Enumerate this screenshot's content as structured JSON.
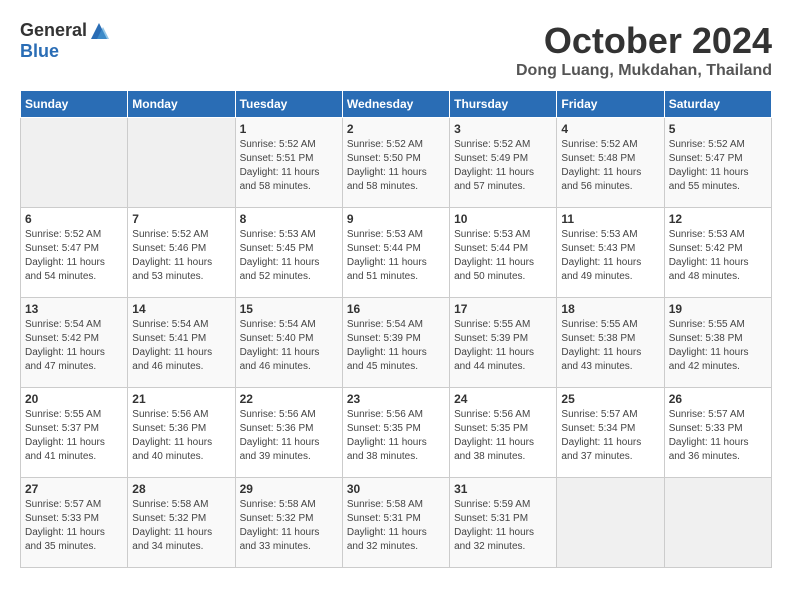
{
  "logo": {
    "general": "General",
    "blue": "Blue"
  },
  "title": "October 2024",
  "subtitle": "Dong Luang, Mukdahan, Thailand",
  "days_of_week": [
    "Sunday",
    "Monday",
    "Tuesday",
    "Wednesday",
    "Thursday",
    "Friday",
    "Saturday"
  ],
  "weeks": [
    [
      {
        "day": "",
        "info": ""
      },
      {
        "day": "",
        "info": ""
      },
      {
        "day": "1",
        "info": "Sunrise: 5:52 AM\nSunset: 5:51 PM\nDaylight: 11 hours and 58 minutes."
      },
      {
        "day": "2",
        "info": "Sunrise: 5:52 AM\nSunset: 5:50 PM\nDaylight: 11 hours and 58 minutes."
      },
      {
        "day": "3",
        "info": "Sunrise: 5:52 AM\nSunset: 5:49 PM\nDaylight: 11 hours and 57 minutes."
      },
      {
        "day": "4",
        "info": "Sunrise: 5:52 AM\nSunset: 5:48 PM\nDaylight: 11 hours and 56 minutes."
      },
      {
        "day": "5",
        "info": "Sunrise: 5:52 AM\nSunset: 5:47 PM\nDaylight: 11 hours and 55 minutes."
      }
    ],
    [
      {
        "day": "6",
        "info": "Sunrise: 5:52 AM\nSunset: 5:47 PM\nDaylight: 11 hours and 54 minutes."
      },
      {
        "day": "7",
        "info": "Sunrise: 5:52 AM\nSunset: 5:46 PM\nDaylight: 11 hours and 53 minutes."
      },
      {
        "day": "8",
        "info": "Sunrise: 5:53 AM\nSunset: 5:45 PM\nDaylight: 11 hours and 52 minutes."
      },
      {
        "day": "9",
        "info": "Sunrise: 5:53 AM\nSunset: 5:44 PM\nDaylight: 11 hours and 51 minutes."
      },
      {
        "day": "10",
        "info": "Sunrise: 5:53 AM\nSunset: 5:44 PM\nDaylight: 11 hours and 50 minutes."
      },
      {
        "day": "11",
        "info": "Sunrise: 5:53 AM\nSunset: 5:43 PM\nDaylight: 11 hours and 49 minutes."
      },
      {
        "day": "12",
        "info": "Sunrise: 5:53 AM\nSunset: 5:42 PM\nDaylight: 11 hours and 48 minutes."
      }
    ],
    [
      {
        "day": "13",
        "info": "Sunrise: 5:54 AM\nSunset: 5:42 PM\nDaylight: 11 hours and 47 minutes."
      },
      {
        "day": "14",
        "info": "Sunrise: 5:54 AM\nSunset: 5:41 PM\nDaylight: 11 hours and 46 minutes."
      },
      {
        "day": "15",
        "info": "Sunrise: 5:54 AM\nSunset: 5:40 PM\nDaylight: 11 hours and 46 minutes."
      },
      {
        "day": "16",
        "info": "Sunrise: 5:54 AM\nSunset: 5:39 PM\nDaylight: 11 hours and 45 minutes."
      },
      {
        "day": "17",
        "info": "Sunrise: 5:55 AM\nSunset: 5:39 PM\nDaylight: 11 hours and 44 minutes."
      },
      {
        "day": "18",
        "info": "Sunrise: 5:55 AM\nSunset: 5:38 PM\nDaylight: 11 hours and 43 minutes."
      },
      {
        "day": "19",
        "info": "Sunrise: 5:55 AM\nSunset: 5:38 PM\nDaylight: 11 hours and 42 minutes."
      }
    ],
    [
      {
        "day": "20",
        "info": "Sunrise: 5:55 AM\nSunset: 5:37 PM\nDaylight: 11 hours and 41 minutes."
      },
      {
        "day": "21",
        "info": "Sunrise: 5:56 AM\nSunset: 5:36 PM\nDaylight: 11 hours and 40 minutes."
      },
      {
        "day": "22",
        "info": "Sunrise: 5:56 AM\nSunset: 5:36 PM\nDaylight: 11 hours and 39 minutes."
      },
      {
        "day": "23",
        "info": "Sunrise: 5:56 AM\nSunset: 5:35 PM\nDaylight: 11 hours and 38 minutes."
      },
      {
        "day": "24",
        "info": "Sunrise: 5:56 AM\nSunset: 5:35 PM\nDaylight: 11 hours and 38 minutes."
      },
      {
        "day": "25",
        "info": "Sunrise: 5:57 AM\nSunset: 5:34 PM\nDaylight: 11 hours and 37 minutes."
      },
      {
        "day": "26",
        "info": "Sunrise: 5:57 AM\nSunset: 5:33 PM\nDaylight: 11 hours and 36 minutes."
      }
    ],
    [
      {
        "day": "27",
        "info": "Sunrise: 5:57 AM\nSunset: 5:33 PM\nDaylight: 11 hours and 35 minutes."
      },
      {
        "day": "28",
        "info": "Sunrise: 5:58 AM\nSunset: 5:32 PM\nDaylight: 11 hours and 34 minutes."
      },
      {
        "day": "29",
        "info": "Sunrise: 5:58 AM\nSunset: 5:32 PM\nDaylight: 11 hours and 33 minutes."
      },
      {
        "day": "30",
        "info": "Sunrise: 5:58 AM\nSunset: 5:31 PM\nDaylight: 11 hours and 32 minutes."
      },
      {
        "day": "31",
        "info": "Sunrise: 5:59 AM\nSunset: 5:31 PM\nDaylight: 11 hours and 32 minutes."
      },
      {
        "day": "",
        "info": ""
      },
      {
        "day": "",
        "info": ""
      }
    ]
  ]
}
